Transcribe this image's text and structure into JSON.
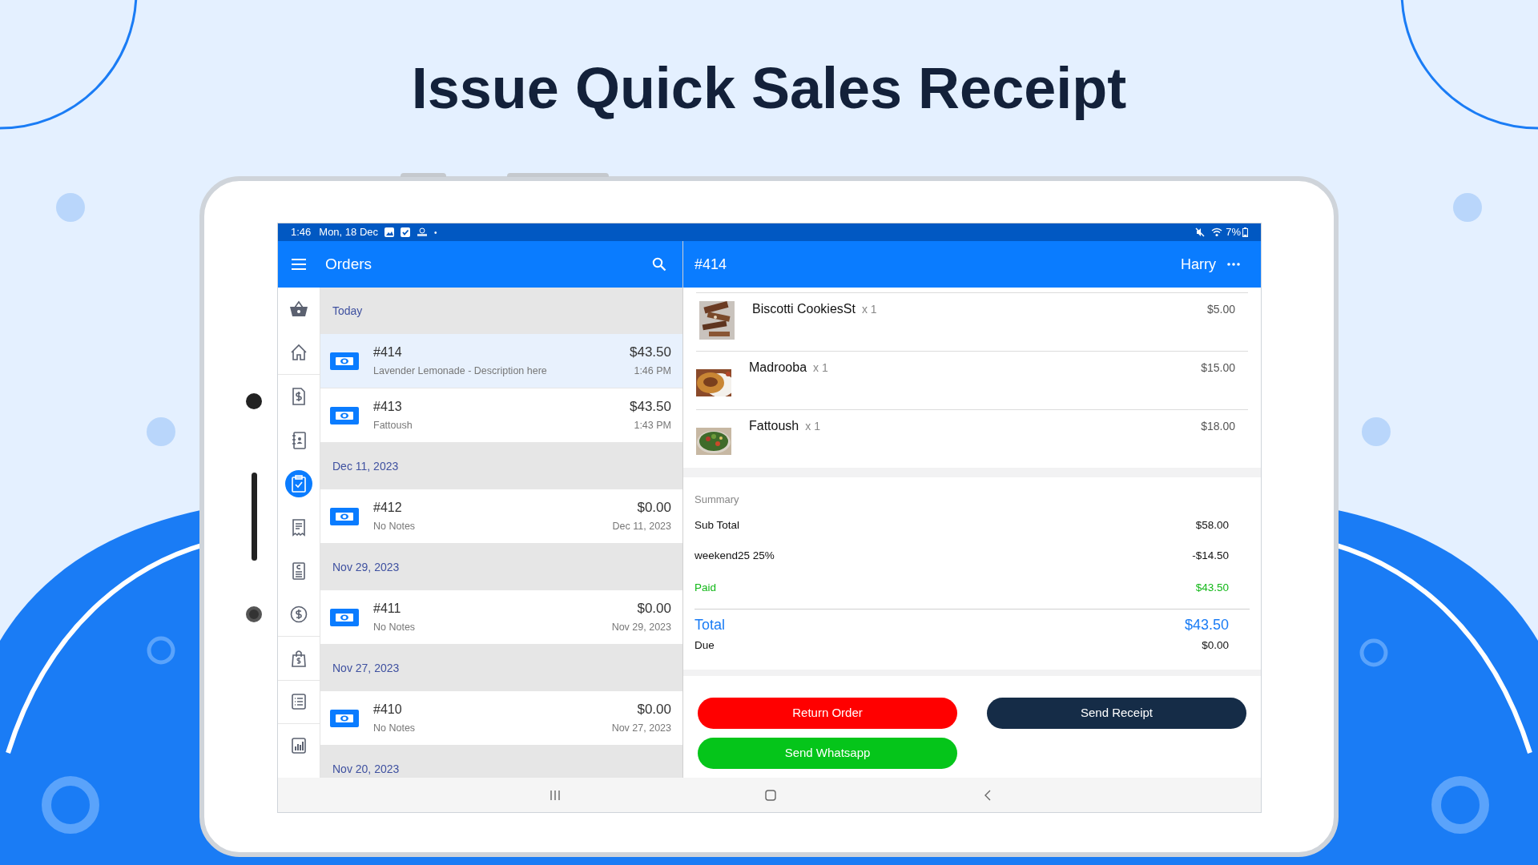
{
  "headline": "Issue Quick Sales Receipt",
  "status_bar": {
    "time": "1:46",
    "date": "Mon, 18 Dec",
    "dot": "•",
    "battery": "7%"
  },
  "list_header": {
    "title": "Orders"
  },
  "rail": [
    {
      "kind": "basket",
      "selected": false
    },
    {
      "kind": "home",
      "selected": false
    },
    {
      "kind": "invoice",
      "selected": false
    },
    {
      "kind": "contacts",
      "selected": false
    },
    {
      "kind": "clipboard",
      "selected": true
    },
    {
      "kind": "receipt",
      "selected": false
    },
    {
      "kind": "document",
      "selected": false
    },
    {
      "kind": "coin",
      "selected": false
    },
    {
      "kind": "bag",
      "selected": false
    },
    {
      "kind": "list",
      "selected": false
    },
    {
      "kind": "chart",
      "selected": false
    }
  ],
  "groups": [
    {
      "date": "Today",
      "orders": [
        {
          "number": "#414",
          "note": "Lavender Lemonade - Description here",
          "amount": "$43.50",
          "time": "1:46 PM",
          "selected": true
        },
        {
          "number": "#413",
          "note": "Fattoush",
          "amount": "$43.50",
          "time": "1:43 PM",
          "selected": false
        }
      ]
    },
    {
      "date": "Dec 11, 2023",
      "orders": [
        {
          "number": "#412",
          "note": "No Notes",
          "amount": "$0.00",
          "time": "Dec 11, 2023",
          "selected": false
        }
      ]
    },
    {
      "date": "Nov 29, 2023",
      "orders": [
        {
          "number": "#411",
          "note": "No Notes",
          "amount": "$0.00",
          "time": "Nov 29, 2023",
          "selected": false
        }
      ]
    },
    {
      "date": "Nov 27, 2023",
      "orders": [
        {
          "number": "#410",
          "note": "No Notes",
          "amount": "$0.00",
          "time": "Nov 27, 2023",
          "selected": false
        }
      ]
    },
    {
      "date": "Nov 20, 2023"
    }
  ],
  "detail": {
    "title": "#414",
    "user": "Harry",
    "items": [
      {
        "name": "Biscotti CookiesSt",
        "qty": "x 1",
        "price": "$5.00"
      },
      {
        "name": "Madrooba",
        "qty": "x 1",
        "price": "$15.00"
      },
      {
        "name": "Fattoush",
        "qty": "x 1",
        "price": "$18.00"
      }
    ],
    "summary": {
      "heading": "Summary",
      "lines": [
        {
          "label": "Sub Total",
          "value": "$58.00",
          "kind": "plain"
        },
        {
          "label": "weekend25 25%",
          "value": "-$14.50",
          "kind": "plain"
        },
        {
          "label": "Paid",
          "value": "$43.50",
          "kind": "paid"
        }
      ],
      "total": {
        "label": "Total",
        "value": "$43.50"
      },
      "due": {
        "label": "Due",
        "value": "$0.00"
      }
    },
    "buttons": [
      {
        "label": "Return Order",
        "color": "#ff0000"
      },
      {
        "label": "Send Receipt",
        "color": "#152c47"
      },
      {
        "label": "Send Whatsapp",
        "color": "#05c51a"
      }
    ]
  }
}
